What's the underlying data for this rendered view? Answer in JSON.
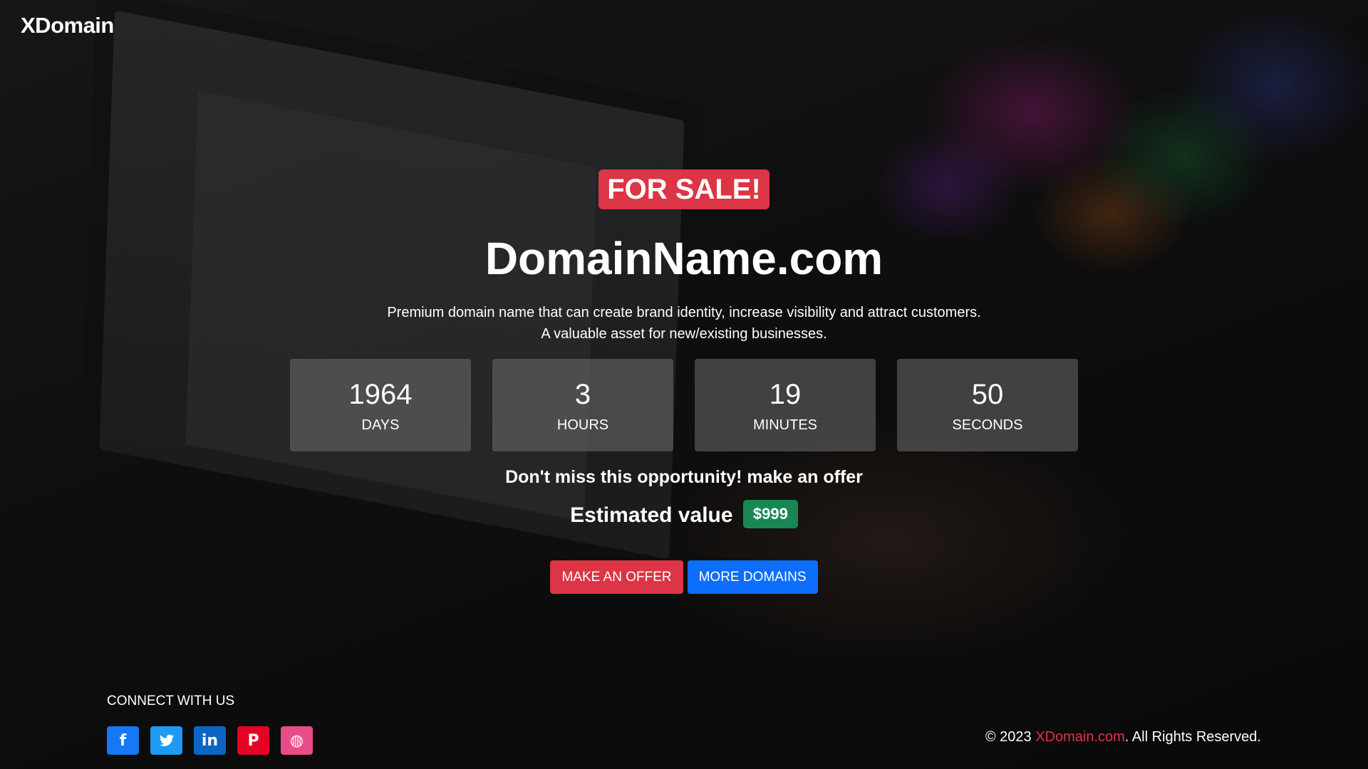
{
  "brand": "XDomain",
  "hero": {
    "badge": "FOR SALE!",
    "domain": "DomainName.com",
    "desc_line1": "Premium domain name that can create brand identity, increase visibility and attract customers.",
    "desc_line2": "A valuable asset for new/existing businesses."
  },
  "countdown": [
    {
      "value": "1964",
      "label": "DAYS"
    },
    {
      "value": "3",
      "label": "HOURS"
    },
    {
      "value": "19",
      "label": "MINUTES"
    },
    {
      "value": "50",
      "label": "SECONDS"
    }
  ],
  "offer": {
    "opportunity": "Don't miss this opportunity! make an offer",
    "estimated_label": "Estimated value",
    "estimated_value": "$999"
  },
  "actions": {
    "make_offer": "MAKE AN OFFER",
    "more_domains": "MORE DOMAINS"
  },
  "footer": {
    "connect_label": "CONNECT WITH US",
    "socials": [
      {
        "name": "facebook-icon",
        "glyph": "f",
        "color": "#1877f2"
      },
      {
        "name": "twitter-icon",
        "glyph": "🐦",
        "color": "#1d9bf0"
      },
      {
        "name": "linkedin-icon",
        "glyph": "in",
        "color": "#0a66c2"
      },
      {
        "name": "pinterest-icon",
        "glyph": "P",
        "color": "#e60023"
      },
      {
        "name": "dribbble-icon",
        "glyph": "◍",
        "color": "#ea4c89"
      }
    ],
    "copyright_prefix": "© 2023 ",
    "copyright_link": "XDomain.com",
    "copyright_suffix": ". All Rights Reserved."
  },
  "colors": {
    "danger": "#dc3545",
    "primary": "#0d6efd",
    "success": "#198754"
  }
}
